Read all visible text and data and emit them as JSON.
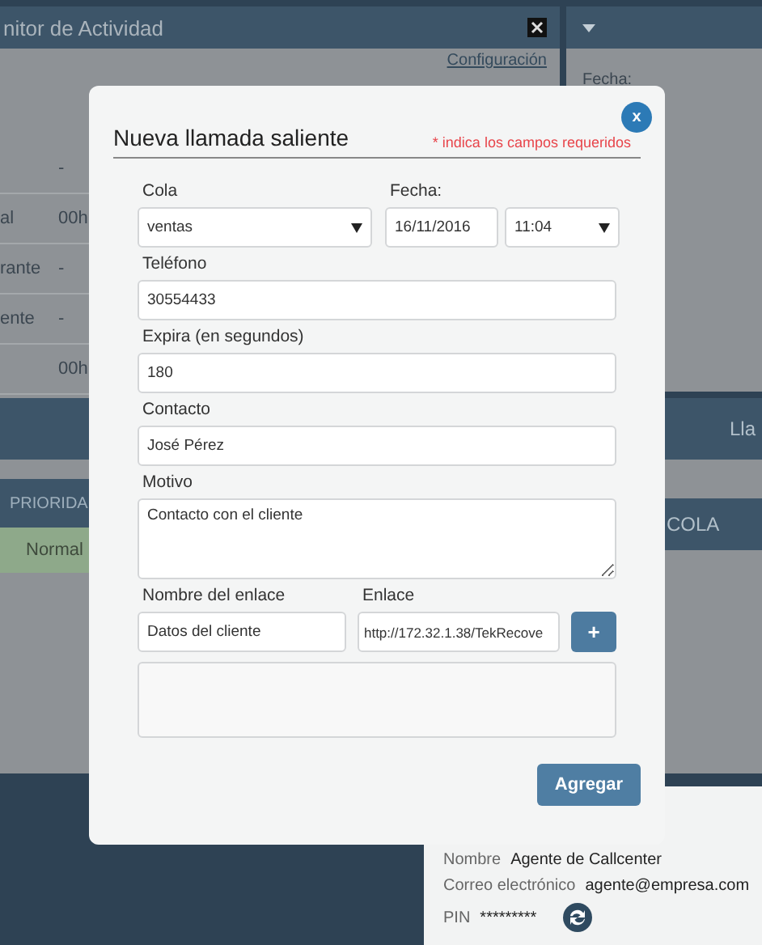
{
  "activity_window": {
    "title": "nitor de Actividad",
    "config_link": "Configuración",
    "rows": [
      {
        "label": "",
        "value": "-"
      },
      {
        "label": "al",
        "value": "00h"
      },
      {
        "label": "rante",
        "value": "-"
      },
      {
        "label": "ente",
        "value": "-"
      },
      {
        "label": "",
        "value": "00h"
      }
    ],
    "table": {
      "columns": [
        "PRIORIDA"
      ],
      "rows": [
        [
          "Normal"
        ]
      ]
    }
  },
  "side_panel": {
    "fields": [
      "Fecha:"
    ],
    "calls_header": "Lla",
    "columns": [
      "COLA"
    ]
  },
  "agent_panel": {
    "name_label": "Nombre",
    "name": "Agente de Callcenter",
    "email_label": "Correo electrónico",
    "email": "agente@empresa.com",
    "pin_label": "PIN",
    "pin": "*********"
  },
  "dialog": {
    "title": "Nueva llamada saliente",
    "required_note": "* indica los campos requeridos",
    "close": "x",
    "queue": {
      "label": "Cola",
      "value": "ventas"
    },
    "date": {
      "label": "Fecha:",
      "value": "16/11/2016",
      "time": "11:04"
    },
    "fields": [
      {
        "kind": "input",
        "label": "Teléfono",
        "value": "30554433"
      },
      {
        "kind": "input",
        "label": "Expira (en segundos)",
        "value": "180"
      },
      {
        "kind": "input",
        "label": "Contacto",
        "value": "José Pérez"
      },
      {
        "kind": "textarea",
        "label": "Motivo",
        "value": "Contacto con el cliente"
      }
    ],
    "link_name": {
      "label": "Nombre del enlace",
      "value": "Datos del cliente"
    },
    "link": {
      "label": "Enlace",
      "value": "http://172.32.1.38/TekRecove"
    },
    "add_link": "+",
    "submit": "Agregar"
  }
}
